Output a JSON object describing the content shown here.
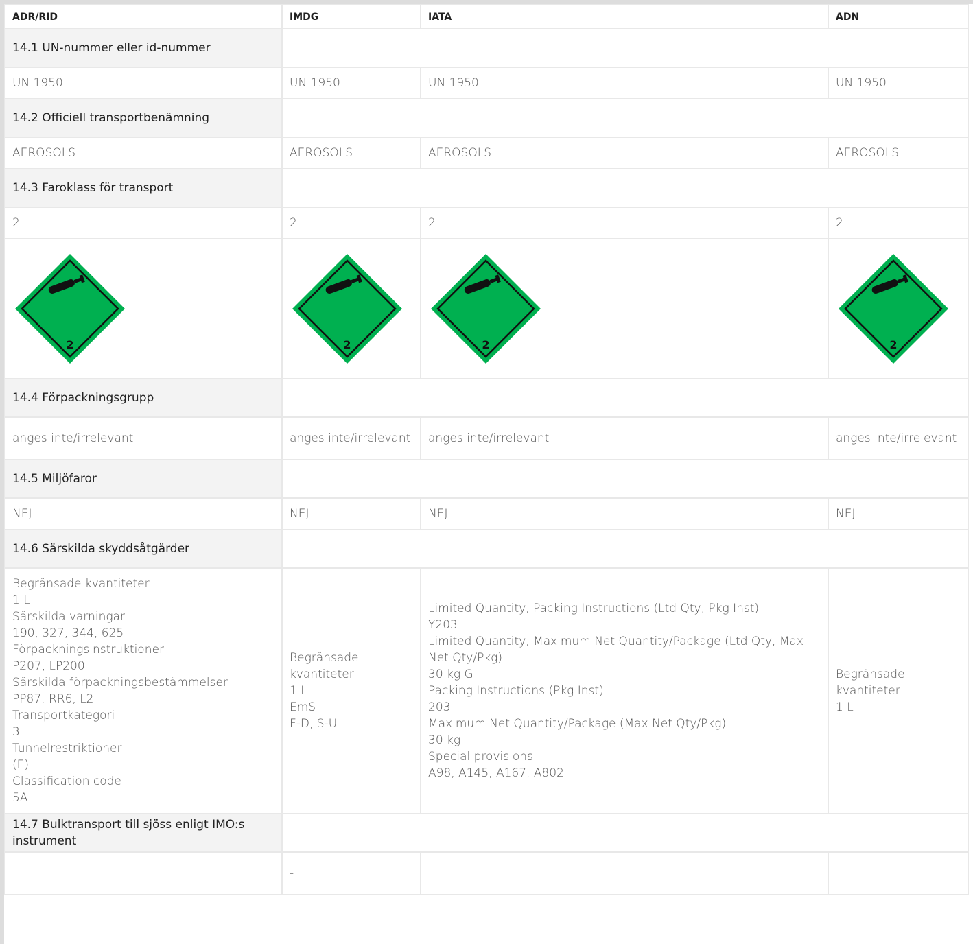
{
  "columns": [
    "ADR/RID",
    "IMDG",
    "IATA",
    "ADN"
  ],
  "hazard_label": {
    "class_number": "2",
    "fill": "#00b050",
    "icon": "gas-cylinder-icon"
  },
  "sections": [
    {
      "title": "14.1 UN-nummer eller id-nummer",
      "values": [
        "UN 1950",
        "UN 1950",
        "UN 1950",
        "UN 1950"
      ]
    },
    {
      "title": "14.2 Officiell transportbenämning",
      "values": [
        "AEROSOLS",
        "AEROSOLS",
        "AEROSOLS",
        "AEROSOLS"
      ]
    },
    {
      "title": "14.3 Faroklass för transport",
      "values": [
        "2",
        "2",
        "2",
        "2"
      ]
    },
    {
      "title": "14.4 Förpackningsgrupp",
      "values": [
        "anges inte/irrelevant",
        "anges inte/irrelevant",
        "anges inte/irrelevant",
        "anges inte/irrelevant"
      ]
    },
    {
      "title": "14.5 Miljöfaror",
      "values": [
        "NEJ",
        "NEJ",
        "NEJ",
        "NEJ"
      ]
    },
    {
      "title": "14.6 Särskilda skyddsåtgärder",
      "lines": [
        [
          "Begränsade kvantiteter",
          "1 L",
          "Särskilda varningar",
          "190, 327, 344, 625",
          "Förpackningsinstruktioner",
          "P207, LP200",
          "Särskilda förpackningsbestämmelser",
          "PP87, RR6, L2",
          "Transportkategori",
          "3",
          "Tunnelrestriktioner",
          "(E)",
          "Classification code",
          "5A"
        ],
        [
          "Begränsade kvantiteter",
          "1 L",
          "EmS",
          "F-D, S-U"
        ],
        [
          "Limited Quantity, Packing Instructions (Ltd Qty, Pkg Inst)",
          "Y203",
          "Limited Quantity, Maximum Net Quantity/Package (Ltd Qty, Max Net Qty/Pkg)",
          "30 kg G",
          "Packing Instructions (Pkg Inst)",
          "203",
          "Maximum Net Quantity/Package (Max Net Qty/Pkg)",
          "30 kg",
          "Special provisions",
          "A98, A145, A167, A802"
        ],
        [
          "Begränsade kvantiteter",
          "1 L"
        ]
      ]
    },
    {
      "title": "14.7 Bulktransport till sjöss enligt IMO:s instrument",
      "values": [
        "",
        "-",
        "",
        ""
      ]
    }
  ]
}
